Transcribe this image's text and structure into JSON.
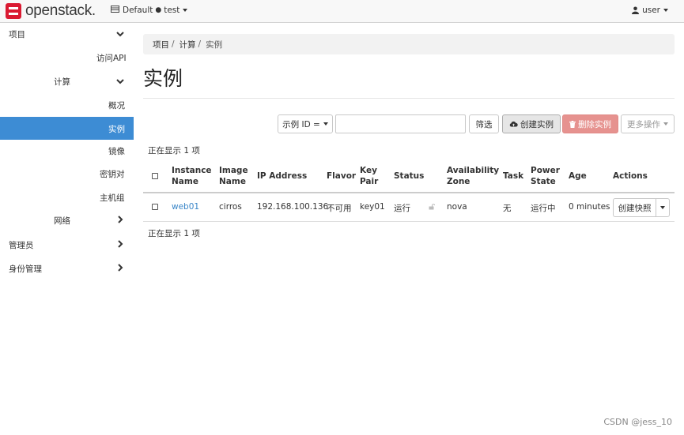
{
  "topbar": {
    "brand": "openstack.",
    "domain": "Default",
    "project": "test",
    "user": "user"
  },
  "sidebar": {
    "project": "项目",
    "api_access": "访问API",
    "compute": "计算",
    "overview": "概况",
    "instances": "实例",
    "images": "镜像",
    "keypairs": "密钥对",
    "server_groups": "主机组",
    "network": "网络",
    "admin": "管理员",
    "identity": "身份管理"
  },
  "breadcrumb": [
    "项目",
    "计算",
    "实例"
  ],
  "page_title": "实例",
  "toolbar": {
    "filter_field": "示例 ID =",
    "filter_value": "",
    "filter_button": "筛选",
    "launch_button": "创建实例",
    "delete_button": "删除实例",
    "more_button": "更多操作"
  },
  "summary_top": "正在显示 1 项",
  "summary_bottom": "正在显示 1 项",
  "table": {
    "headers": {
      "name": [
        "Instance",
        "Name"
      ],
      "image": [
        "Image",
        "Name"
      ],
      "ip": "IP Address",
      "flavor": "Flavor",
      "keypair": [
        "Key",
        "Pair"
      ],
      "status": "Status",
      "az": [
        "Availability",
        "Zone"
      ],
      "task": "Task",
      "power": [
        "Power",
        "State"
      ],
      "age": "Age",
      "actions": "Actions"
    },
    "rows": [
      {
        "name": "web01",
        "image": "cirros",
        "ip": "192.168.100.136",
        "flavor": "不可用",
        "keypair": "key01",
        "status": "运行",
        "az": "nova",
        "task": "无",
        "power": "运行中",
        "age": "0 minutes",
        "action": "创建快照"
      }
    ]
  },
  "watermark": "CSDN @jess_10",
  "colors": {
    "sidebar_active": "#3d8cd4",
    "delete_button": "#e6928f",
    "link": "#3a86c8",
    "brand_red": "#da1a32"
  }
}
